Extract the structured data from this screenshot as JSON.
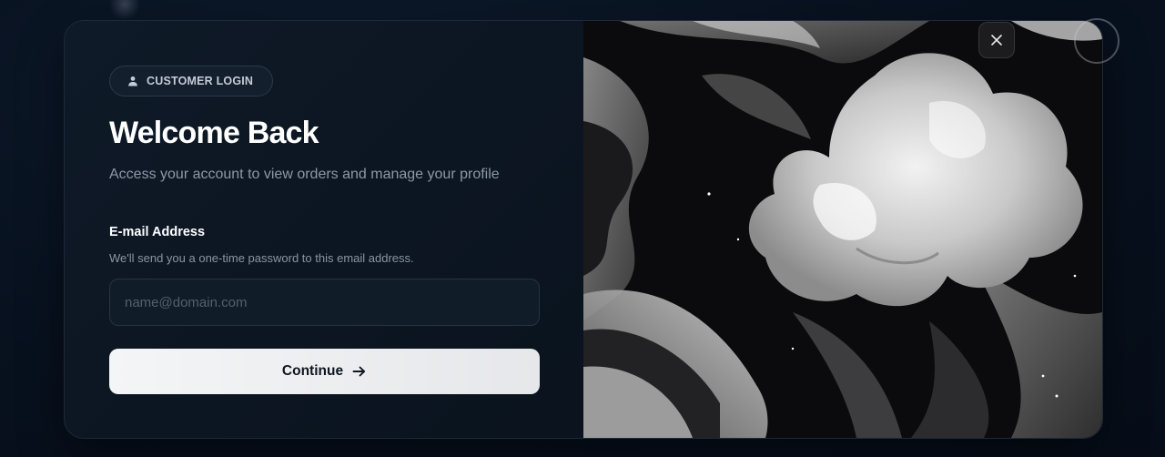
{
  "badge": {
    "icon": "user-icon",
    "label": "CUSTOMER LOGIN"
  },
  "heading": {
    "title": "Welcome Back",
    "subtitle": "Access your account to view orders and manage your profile"
  },
  "email": {
    "label": "E-mail Address",
    "help": "We'll send you a one-time password to this email address.",
    "value": "",
    "placeholder": "name@domain.com"
  },
  "continue_button": {
    "label": "Continue",
    "icon": "arrow-right-icon"
  },
  "close_button": {
    "icon": "close-icon"
  },
  "colors": {
    "page_background": "#081220",
    "panel_background": "#0f1a28",
    "heading_text": "#ffffff",
    "muted_text": "#8d98a7",
    "button_background": "#f1f2f4",
    "button_text": "#0f1620"
  }
}
